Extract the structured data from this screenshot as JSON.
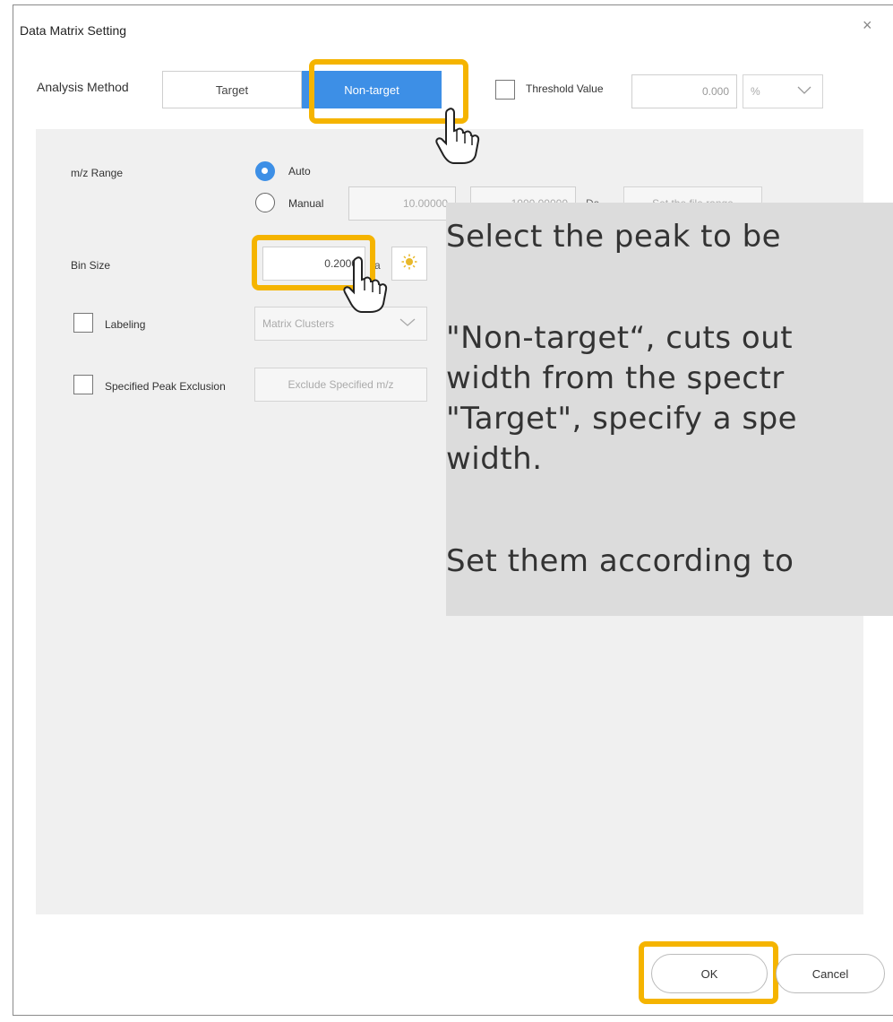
{
  "dialog": {
    "title": "Data Matrix Setting",
    "close_glyph": "×"
  },
  "analysis_method": {
    "label": "Analysis Method",
    "options": [
      "Target",
      "Non-target"
    ],
    "selected": "Non-target"
  },
  "threshold": {
    "label": "Threshold Value",
    "value": "0.000",
    "unit": "%",
    "checked": false
  },
  "mz_range": {
    "label": "m/z Range",
    "auto_label": "Auto",
    "manual_label": "Manual",
    "selected": "Auto",
    "min_value": "10.00000",
    "max_value": "1000.00000",
    "unit": "Da",
    "file_range_button": "Set the file range"
  },
  "bin_size": {
    "label": "Bin Size",
    "value": "0.2000",
    "unit": "a"
  },
  "labeling": {
    "label": "Labeling",
    "checked": false,
    "dropdown_value": "Matrix Clusters"
  },
  "peak_exclusion": {
    "label": "Specified Peak Exclusion",
    "checked": false,
    "button": "Exclude Specified m/z"
  },
  "footer": {
    "ok": "OK",
    "cancel": "Cancel"
  },
  "tooltip": {
    "lines": [
      "Select the peak to be",
      "",
      "\"Non-target“, cuts out",
      "width from the spectr",
      "\"Target\", specify a spe",
      "width.",
      "",
      "Set them according to"
    ]
  },
  "colors": {
    "accent": "#3d8fe6",
    "highlight": "#f5b400",
    "panel": "#f0f0f0",
    "overlay": "#dcdcdc"
  }
}
